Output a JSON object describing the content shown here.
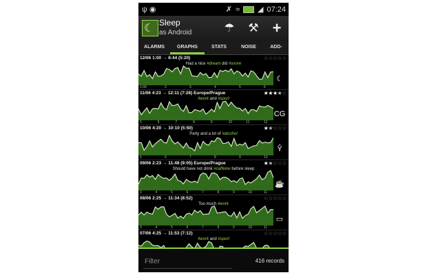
{
  "status": {
    "time": "07:24",
    "left_icons": [
      "usb-icon",
      "android-icon"
    ],
    "right_icons": [
      "mute-icon",
      "wifi-icon",
      "battery-icon",
      "signal-icon"
    ]
  },
  "app": {
    "title": "Sleep",
    "subtitle": "as Android",
    "actions": [
      "umbrella-icon",
      "wrench-icon",
      "plus-icon"
    ]
  },
  "tabs": [
    {
      "label": "ALARMS",
      "selected": false
    },
    {
      "label": "GRAPHS",
      "selected": true
    },
    {
      "label": "STATS",
      "selected": false
    },
    {
      "label": "NOISE",
      "selected": false
    },
    {
      "label": "ADD-",
      "selected": false
    }
  ],
  "records": [
    {
      "header": "12/06 1:00 → 6:44 (5:20)",
      "rating": 0,
      "note": [
        {
          "t": "Had a nice "
        },
        {
          "t": "#dream",
          "tag": true
        },
        {
          "t": " did "
        },
        {
          "t": "#snore",
          "tag": true
        }
      ],
      "ticks": [
        "1:00",
        "2",
        "3",
        "4",
        "5",
        "6"
      ],
      "icon": "moon-cloud-icon",
      "icon_glyph": "☾"
    },
    {
      "header": "11/06 4:23 → 12:11 (7:28) Europe/Prague",
      "rating": 3.5,
      "note": [
        {
          "t": "#work",
          "tag": true
        },
        {
          "t": " and "
        },
        {
          "t": "#sport",
          "tag": true
        }
      ],
      "ticks": [
        "5",
        "6",
        "7",
        "8",
        "9",
        "10",
        "11",
        "12"
      ],
      "icon": "laptop-cg-icon",
      "icon_glyph": "CG"
    },
    {
      "header": "10/06 4:20 → 10:10 (5:50)",
      "rating": 1.5,
      "note": [
        {
          "t": "Party and a lot of "
        },
        {
          "t": "#alcohol",
          "tag": true
        }
      ],
      "ticks": [
        "5",
        "6",
        "7",
        "8",
        "9",
        "10"
      ],
      "icon": "cocktail-icon",
      "icon_glyph": "Ŷ"
    },
    {
      "header": "09/06 2:23 → 11:48 (9:05) Europe/Prague",
      "rating": 1.5,
      "note": [
        {
          "t": "Should have not drink "
        },
        {
          "t": "#caffeine",
          "tag": true
        },
        {
          "t": " before sleep"
        }
      ],
      "ticks": [
        "3",
        "4",
        "5",
        "6",
        "7",
        "8",
        "9",
        "10",
        "11"
      ],
      "icon": "coffee-cup-icon",
      "icon_glyph": "☕"
    },
    {
      "header": "08/06 2:25 → 11:34 (8:52)",
      "rating": 0,
      "note": [
        {
          "t": "Too much "
        },
        {
          "t": "#work",
          "tag": true
        }
      ],
      "ticks": [
        "3",
        "4",
        "5",
        "6",
        "7",
        "8",
        "9",
        "10",
        "11"
      ],
      "icon": "laptop-icon",
      "icon_glyph": "▭"
    },
    {
      "header": "07/06 4:25 → 11:53 (7:12)",
      "rating": 0,
      "note": [
        {
          "t": "#work",
          "tag": true
        },
        {
          "t": " and "
        },
        {
          "t": "#sport",
          "tag": true
        }
      ],
      "ticks": [],
      "icon": "laptop-icon",
      "icon_glyph": ""
    }
  ],
  "bottom": {
    "filter_placeholder": "Filter",
    "records_count": "416 records"
  },
  "colors": {
    "accent": "#8fd13a",
    "graph_fill": "#2f6b1a",
    "graph_line": "#d8e8c8"
  }
}
